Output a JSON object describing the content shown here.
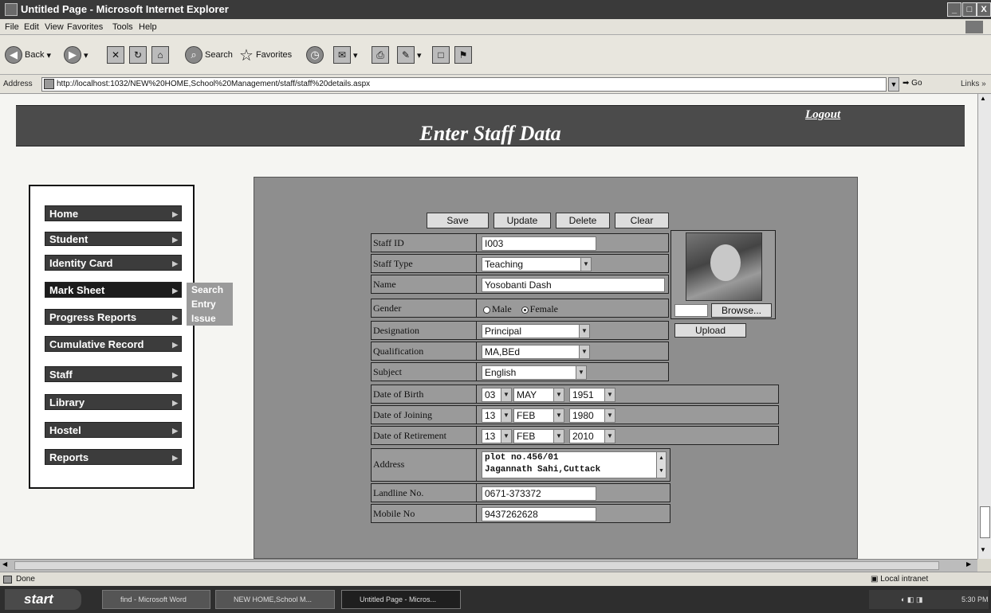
{
  "window": {
    "title": "Untitled Page - Microsoft Internet Explorer",
    "controls": [
      "_",
      "□",
      "X"
    ]
  },
  "menubar": {
    "items": [
      "File",
      "Edit",
      "View",
      "Favorites",
      "Tools",
      "Help"
    ]
  },
  "toolbar": {
    "back_label": "Back",
    "search_label": "Search",
    "favorites_label": "Favorites"
  },
  "addressbar": {
    "label": "Address",
    "url": "http://localhost:1032/NEW%20HOME,School%20Management/staff/staff%20details.aspx",
    "go_label": "Go",
    "links_label": "Links »"
  },
  "page": {
    "title": "Enter Staff Data",
    "logout": "Logout"
  },
  "sidemenu": {
    "items": [
      "Home",
      "Student",
      "Identity Card",
      "Mark Sheet",
      "Progress Reports",
      "Cumulative Record",
      "Staff",
      "Library",
      "Hostel",
      "Reports"
    ],
    "flyout": [
      "Search",
      "Entry",
      "Issue"
    ]
  },
  "form": {
    "buttons": {
      "save": "Save",
      "update": "Update",
      "delete": "Delete",
      "clear": "Clear"
    },
    "labels": {
      "staff_id": "Staff ID",
      "staff_type": "Staff Type",
      "name": "Name",
      "gender": "Gender",
      "designation": "Designation",
      "qualification": "Qualification",
      "subject": "Subject",
      "dob": "Date of Birth",
      "doj": "Date of Joining",
      "dor": "Date of Retirement",
      "address": "Address",
      "landline": "Landline No.",
      "mobile": "Mobile No"
    },
    "values": {
      "staff_id": "I003",
      "staff_type": "Teaching",
      "name": "Yosobanti Dash",
      "gender_male": "Male",
      "gender_female": "Female",
      "gender_selected": "Female",
      "designation": "Principal",
      "qualification": "MA,BEd",
      "subject": "English",
      "dob": {
        "day": "03",
        "month": "MAY",
        "year": "1951"
      },
      "doj": {
        "day": "13",
        "month": "FEB",
        "year": "1980"
      },
      "dor": {
        "day": "13",
        "month": "FEB",
        "year": "2010"
      },
      "address_line1": "plot no.456/01",
      "address_line2": "Jagannath Sahi,Cuttack",
      "landline": "0671-373372",
      "mobile": "9437262628"
    },
    "browse_label": "Browse...",
    "upload_label": "Upload"
  },
  "statusbar": {
    "status": "Done",
    "zone": "Local intranet"
  },
  "taskbar": {
    "start": "start",
    "tasks": [
      "find - Microsoft Word",
      "NEW HOME,School M...",
      "Untitled Page - Micros..."
    ],
    "clock": "5:30 PM"
  }
}
